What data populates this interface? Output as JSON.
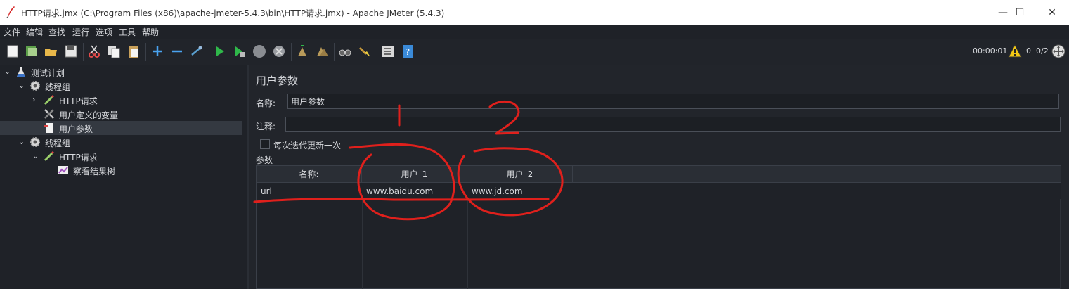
{
  "window": {
    "title": "HTTP请求.jmx (C:\\Program Files (x86)\\apache-jmeter-5.4.3\\bin\\HTTP请求.jmx) - Apache JMeter (5.4.3)",
    "controls": [
      "—",
      "☐",
      "✕"
    ]
  },
  "menu": [
    "文件",
    "编辑",
    "查找",
    "运行",
    "选项",
    "工具",
    "帮助"
  ],
  "toolbar": {
    "icons": [
      "new-icon",
      "templates-icon",
      "open-icon",
      "save-icon",
      "cut-icon",
      "copy-icon",
      "paste-icon",
      "expand-icon",
      "collapse-icon",
      "toggle-icon",
      "start-icon",
      "start-no-pause-icon",
      "stop-icon",
      "shutdown-icon",
      "clear-icon",
      "clear-all-icon",
      "search-icon",
      "reset-search-icon",
      "function-helper-icon",
      "help-icon"
    ],
    "elapsed": "00:00:01",
    "warnings": "0",
    "threads": "0/2"
  },
  "tree": [
    {
      "label": "测试计划",
      "icon": "flask-icon",
      "level": 0,
      "expanded": true
    },
    {
      "label": "线程组",
      "icon": "gear-icon",
      "level": 1,
      "expanded": true
    },
    {
      "label": "HTTP请求",
      "icon": "pipette-icon",
      "level": 2,
      "expanded": false
    },
    {
      "label": "用户定义的变量",
      "icon": "tools-icon",
      "level": 2
    },
    {
      "label": "用户参数",
      "icon": "document-icon",
      "level": 2,
      "selected": true
    },
    {
      "label": "线程组",
      "icon": "gear-icon",
      "level": 1,
      "expanded": true
    },
    {
      "label": "HTTP请求",
      "icon": "pipette-icon",
      "level": 2,
      "expanded": true
    },
    {
      "label": "察看结果树",
      "icon": "chart-icon",
      "level": 3
    }
  ],
  "panel": {
    "title": "用户参数",
    "name_label": "名称:",
    "name_value": "用户参数",
    "comment_label": "注释:",
    "comment_value": "",
    "checkbox_label": "每次迭代更新一次",
    "checkbox_checked": false,
    "params_label": "参数"
  },
  "table": {
    "headers": [
      "名称:",
      "用户_1",
      "用户_2"
    ],
    "rows": [
      [
        "url",
        "www.baidu.com",
        "www.jd.com"
      ]
    ]
  },
  "annotations": {
    "number_1": "1",
    "number_2": "2",
    "color": "#e0201c"
  }
}
